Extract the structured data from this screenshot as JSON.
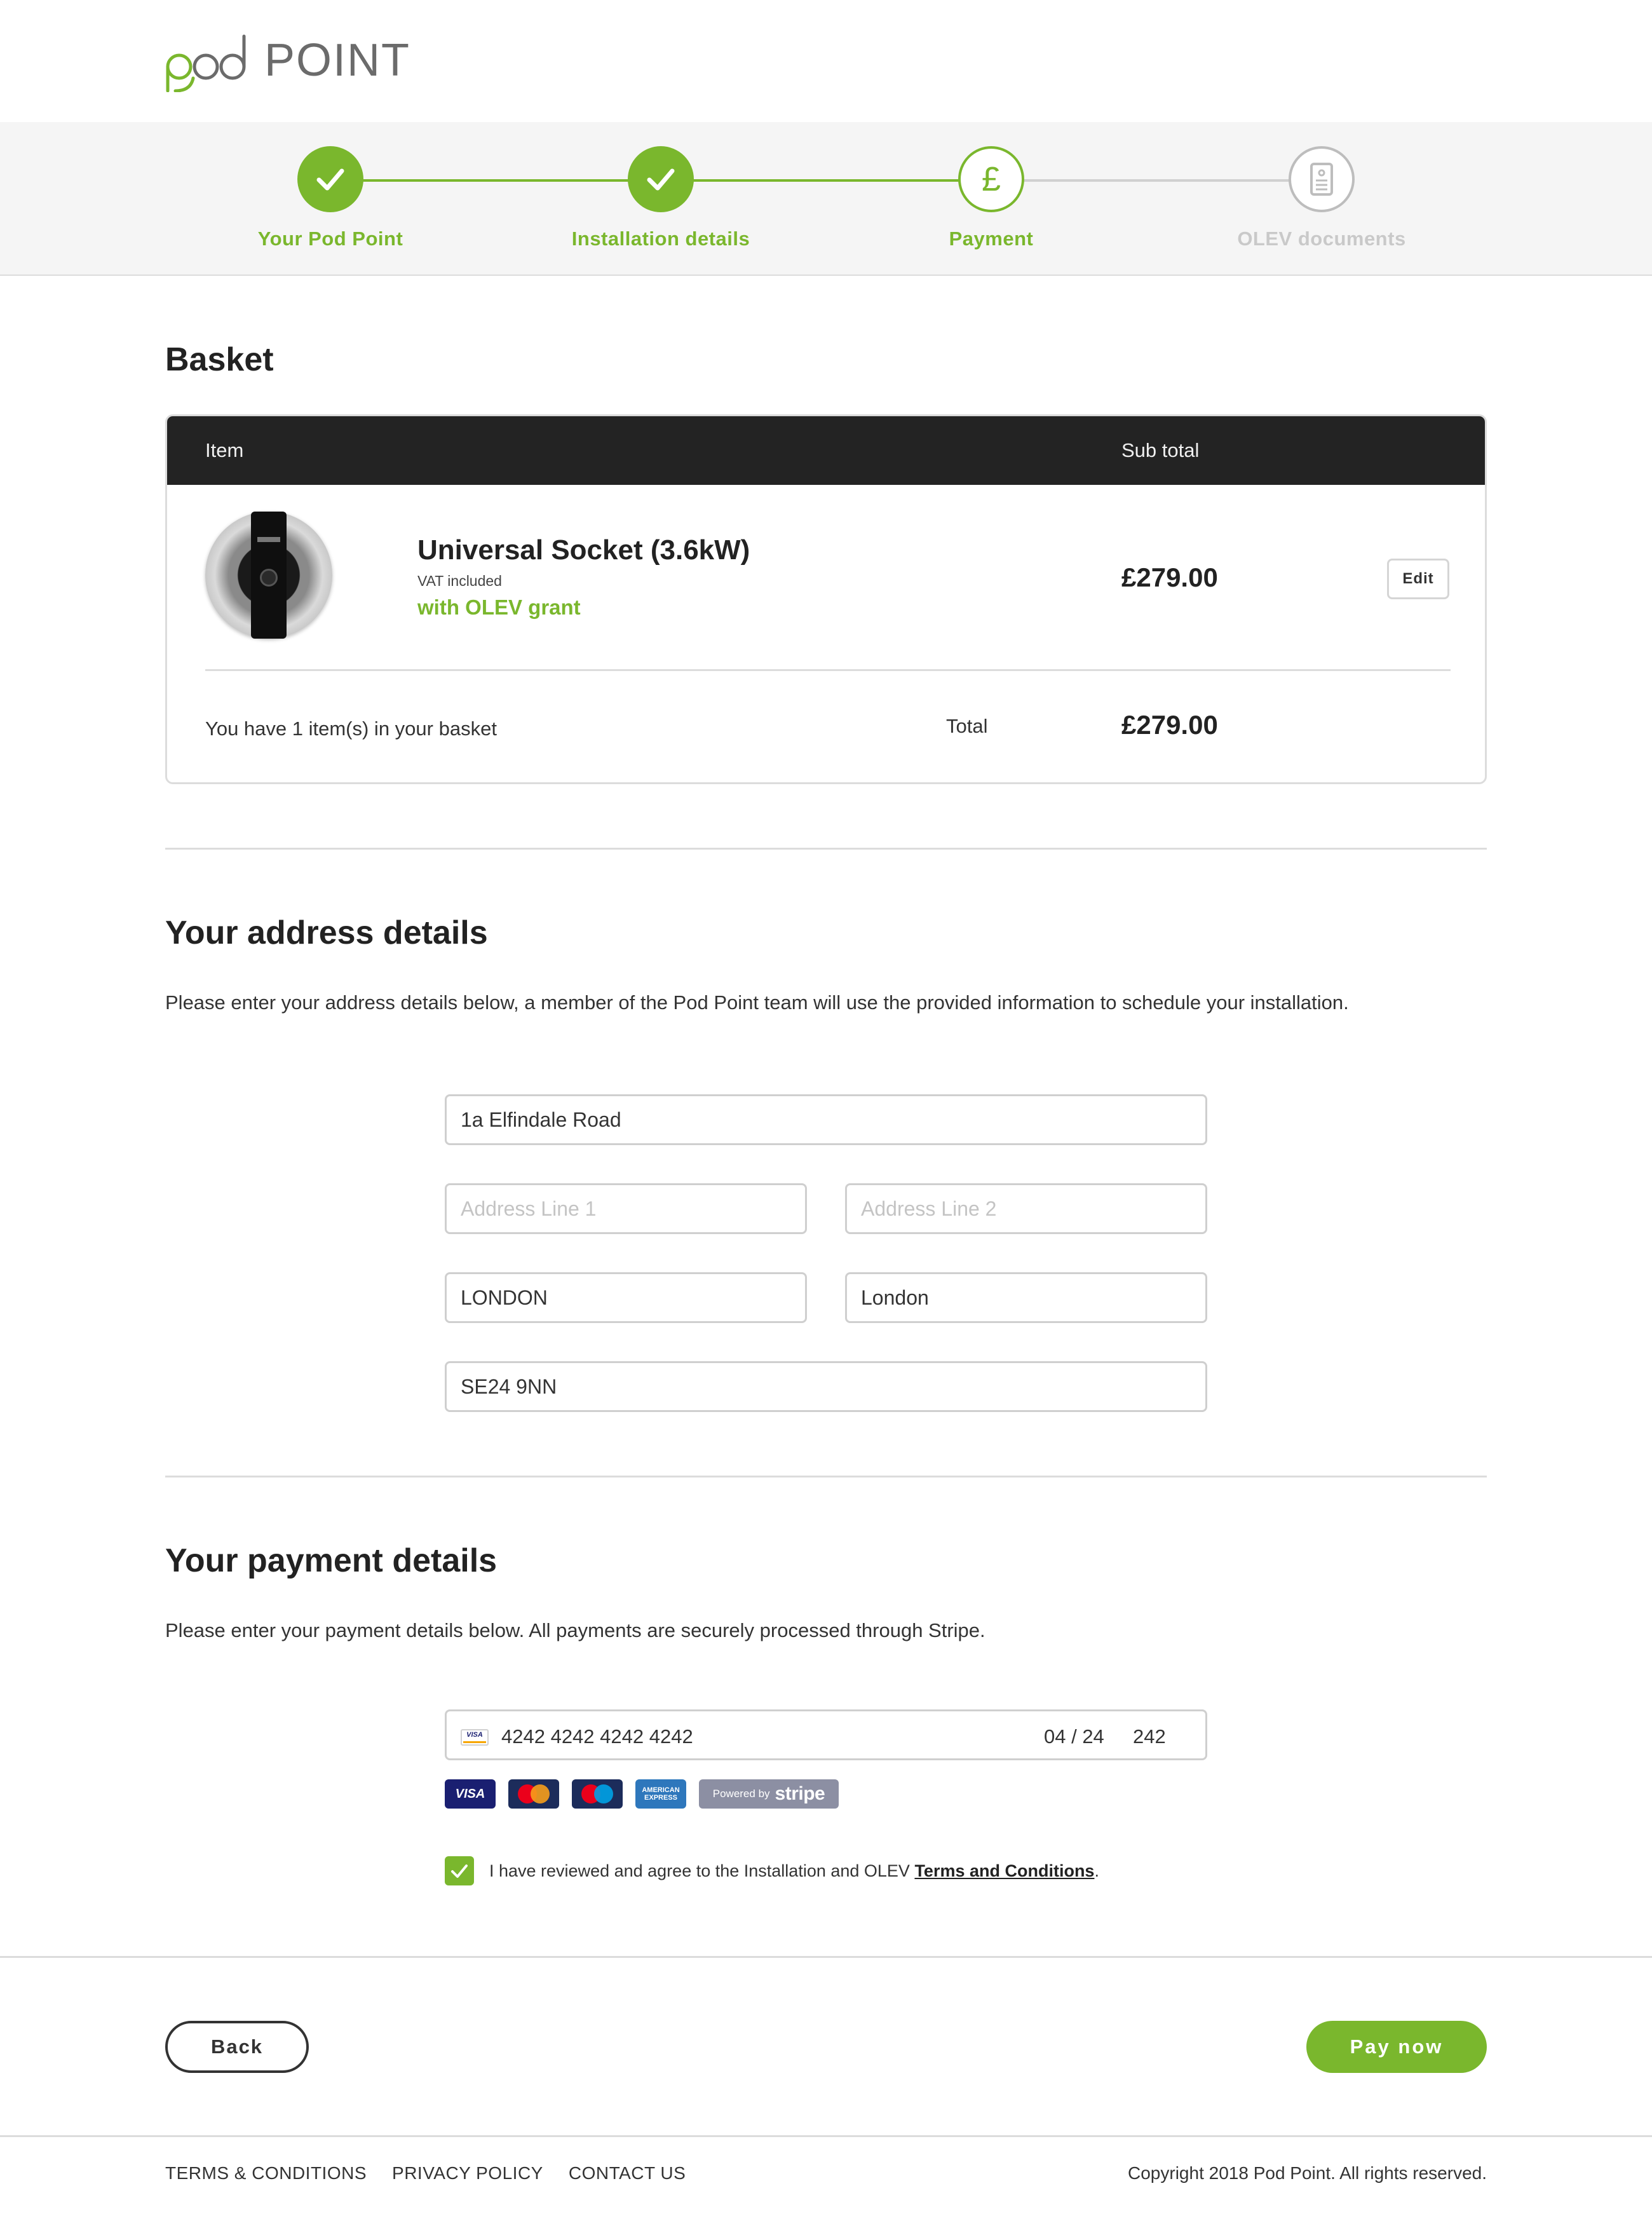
{
  "header": {
    "logo_word": "POINT"
  },
  "steps": [
    {
      "label": "Your Pod Point",
      "state": "done",
      "icon": "check-icon"
    },
    {
      "label": "Installation details",
      "state": "done",
      "icon": "check-icon"
    },
    {
      "label": "Payment",
      "state": "current",
      "icon": "pound-icon"
    },
    {
      "label": "OLEV documents",
      "state": "pending",
      "icon": "document-icon"
    }
  ],
  "basket": {
    "title": "Basket",
    "col_item": "Item",
    "col_subtotal": "Sub total",
    "product_name": "Universal Socket (3.6kW)",
    "vat_note": "VAT included",
    "grant": "with OLEV grant",
    "price": "£279.00",
    "edit_label": "Edit",
    "count_text": "You have 1 item(s) in your basket",
    "total_label": "Total",
    "total_value": "£279.00"
  },
  "address": {
    "title": "Your address details",
    "intro": "Please enter your address details below, a member of the Pod Point team will use the provided information to schedule your installation.",
    "address_lookup_value": "1a Elfindale Road",
    "line1_placeholder": "Address Line 1",
    "line2_placeholder": "Address Line 2",
    "town_value": "LONDON",
    "county_value": "London",
    "postcode_value": "SE24 9NN"
  },
  "payment": {
    "title": "Your payment details",
    "intro": "Please enter your payment details below. All payments are securely processed through Stripe.",
    "card_brand_mini": "VISA",
    "card_number": "4242 4242 4242 4242",
    "expiry": "04 / 24",
    "cvc": "242",
    "badges": {
      "visa": "VISA",
      "mastercard": "MasterCard",
      "maestro": "Maestro",
      "amex": "AMERICAN EXPRESS",
      "stripe_prefix": "Powered by",
      "stripe_word": "stripe"
    },
    "agree_text": "I have reviewed and agree to the Installation and OLEV ",
    "agree_link": "Terms and Conditions",
    "agree_end": ".",
    "agree_checked": true
  },
  "actions": {
    "back_label": "Back",
    "pay_label": "Pay now"
  },
  "footer": {
    "links": [
      "TERMS & CONDITIONS",
      "PRIVACY POLICY",
      "CONTACT US"
    ],
    "copyright": "Copyright 2018 Pod Point. All rights reserved."
  },
  "colors": {
    "brand_green": "#7ab72d",
    "dark_header": "#232323",
    "border_grey": "#dcdcdc"
  }
}
